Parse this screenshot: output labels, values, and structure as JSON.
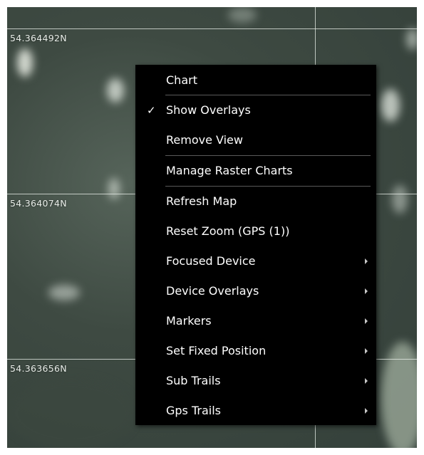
{
  "map": {
    "latitude_labels": [
      "54.364492N",
      "54.364074N",
      "54.363656N"
    ]
  },
  "context_menu": {
    "items": [
      {
        "label": "Chart",
        "checked": false,
        "has_submenu": false,
        "separator_after": true
      },
      {
        "label": "Show Overlays",
        "checked": true,
        "has_submenu": false,
        "separator_after": false
      },
      {
        "label": "Remove View",
        "checked": false,
        "has_submenu": false,
        "separator_after": true
      },
      {
        "label": "Manage Raster Charts",
        "checked": false,
        "has_submenu": false,
        "separator_after": true
      },
      {
        "label": "Refresh Map",
        "checked": false,
        "has_submenu": false,
        "separator_after": false
      },
      {
        "label": "Reset Zoom (GPS (1))",
        "checked": false,
        "has_submenu": false,
        "separator_after": false
      },
      {
        "label": "Focused Device",
        "checked": false,
        "has_submenu": true,
        "separator_after": false
      },
      {
        "label": "Device Overlays",
        "checked": false,
        "has_submenu": true,
        "separator_after": false
      },
      {
        "label": "Markers",
        "checked": false,
        "has_submenu": true,
        "separator_after": false
      },
      {
        "label": "Set Fixed Position",
        "checked": false,
        "has_submenu": true,
        "separator_after": false
      },
      {
        "label": "Sub Trails",
        "checked": false,
        "has_submenu": true,
        "separator_after": false
      },
      {
        "label": "Gps Trails",
        "checked": false,
        "has_submenu": true,
        "separator_after": false
      }
    ],
    "check_glyph": "✓",
    "colors": {
      "background": "#000000",
      "text": "#ffffff",
      "separator": "#5a5a5a"
    }
  }
}
